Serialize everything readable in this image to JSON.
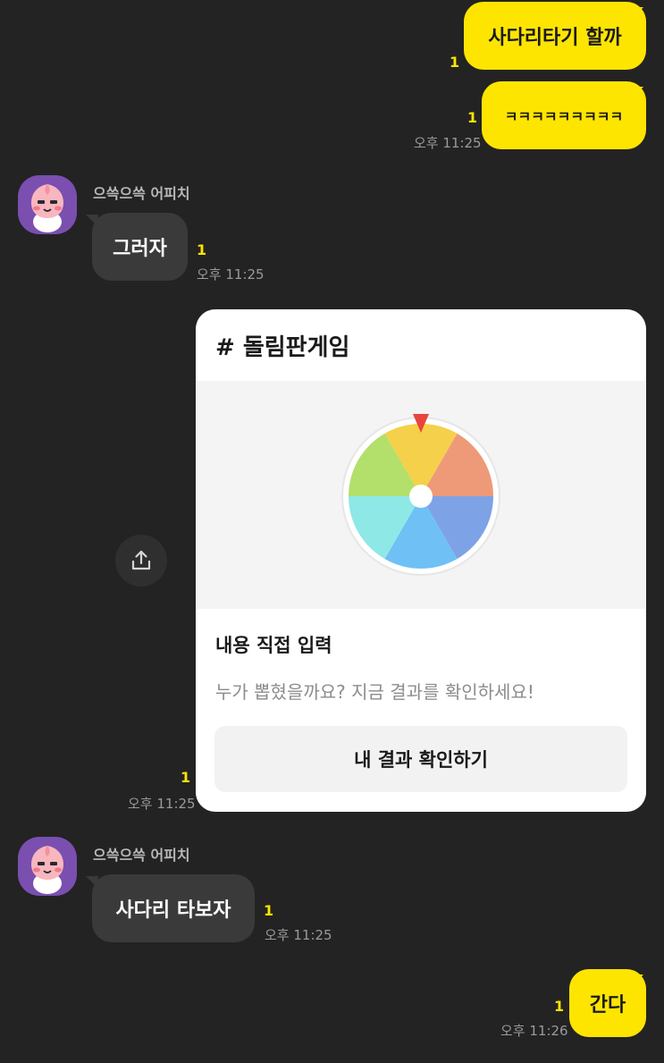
{
  "messages": {
    "m1": {
      "text": "사다리타기 할까",
      "unread": "1"
    },
    "m2": {
      "text": "ㅋㅋㅋㅋㅋㅋㅋㅋㅋ",
      "unread": "1",
      "time": "오후 11:25"
    },
    "m3": {
      "sender": "으쓱으쓱 어피치",
      "text": "그러자",
      "unread": "1",
      "time": "오후 11:25"
    },
    "card": {
      "title": "# 돌림판게임",
      "heading": "내용 직접 입력",
      "description": "누가 뽑혔을까요? 지금 결과를 확인하세요!",
      "button_label": "내 결과 확인하기",
      "unread": "1",
      "time": "오후 11:25"
    },
    "m4": {
      "sender": "으쓱으쓱 어피치",
      "text": "사다리 타보자",
      "unread": "1",
      "time": "오후 11:25"
    },
    "m5": {
      "text": "간다",
      "unread": "1",
      "time": "오후 11:26"
    }
  },
  "wheel": {
    "segment_colors": [
      "#f5d04a",
      "#ee9a78",
      "#7ea2e6",
      "#6fc0f5",
      "#8ee8e6",
      "#b2e06a"
    ],
    "pointer_color": "#e8453c"
  },
  "theme": {
    "my_bubble": "#fee500",
    "other_bubble": "#3a3a3a",
    "background": "#232323"
  },
  "icons": {
    "share": "share-upload-icon",
    "avatar": "apeach-avatar"
  }
}
